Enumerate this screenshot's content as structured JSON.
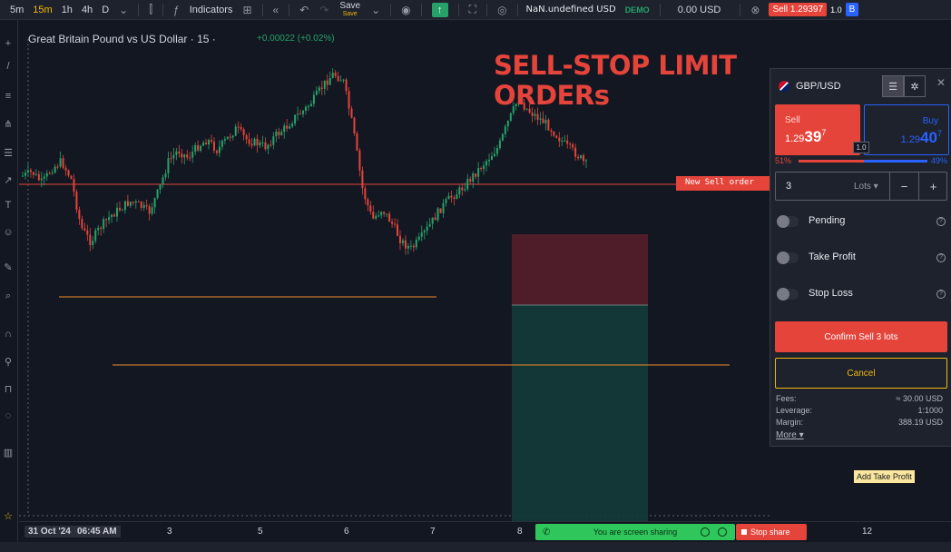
{
  "toolbar": {
    "timeframes": [
      "5m",
      "15m",
      "1h",
      "4h",
      "D"
    ],
    "active_timeframe": "15m",
    "indicators_label": "Indicators",
    "save_label": "Save",
    "save_sub_label": "Save",
    "account_label": "NaN.undefined USD",
    "account_mode": "DEMO",
    "balance": "0.00 USD",
    "sell_label": "Sell 1.29397",
    "lot": "1.0",
    "buy_label": "B"
  },
  "chart": {
    "title": "Great Britain Pound vs US Dollar · 15 ·",
    "change": "+0.00022 (+0.02%)",
    "overlay_title_1": "SELL-STOP LIMIT",
    "overlay_title_2": "ORDERs",
    "new_sell_label": "New Sell order",
    "add_tp_label": "Add Take Profit",
    "colors": {
      "up": "#26a269",
      "down": "#e5443b",
      "sell_line": "#e5443b",
      "level_line": "#f28c28"
    }
  },
  "chart_data": {
    "type": "candlestick",
    "x_labels": [
      "31 Oct '24  06:45 AM",
      "3",
      "5",
      "6",
      "7",
      "8",
      "12"
    ],
    "trend": [
      0.42,
      0.43,
      0.4,
      0.44,
      0.46,
      0.41,
      0.28,
      0.24,
      0.28,
      0.31,
      0.33,
      0.35,
      0.34,
      0.32,
      0.38,
      0.46,
      0.49,
      0.47,
      0.5,
      0.52,
      0.49,
      0.52,
      0.55,
      0.52,
      0.51,
      0.5,
      0.53,
      0.55,
      0.58,
      0.6,
      0.63,
      0.67,
      0.7,
      0.68,
      0.55,
      0.38,
      0.3,
      0.33,
      0.29,
      0.24,
      0.22,
      0.25,
      0.29,
      0.33,
      0.36,
      0.38,
      0.41,
      0.44,
      0.47,
      0.5,
      0.57,
      0.63,
      0.6,
      0.58,
      0.56,
      0.53,
      0.5,
      0.48,
      0.45
    ]
  },
  "price_line_label": "New Sell order",
  "timeaxis": {
    "dates": [
      {
        "label": "31 Oct '24",
        "bold": true
      },
      {
        "label": "06:45 AM",
        "bold": true
      },
      {
        "label": "3",
        "bold": false
      },
      {
        "label": "5",
        "bold": false
      },
      {
        "label": "6",
        "bold": false
      },
      {
        "label": "7",
        "bold": false
      },
      {
        "label": "8",
        "bold": false
      },
      {
        "label": "12",
        "bold": false
      }
    ],
    "share_text": "You are screen sharing",
    "stop_share_label": "Stop share"
  },
  "panel": {
    "symbol": "GBP/USD",
    "sell_label": "Sell",
    "sell_price_small": "1.29",
    "sell_price_big": "39",
    "sell_price_sup": "7",
    "buy_label": "Buy",
    "buy_price_small": "1.29",
    "buy_price_big": "40",
    "buy_price_sup": "7",
    "spread": "1.0",
    "sell_pct": "51%",
    "buy_pct": "49%",
    "sell_share": 0.51,
    "quantity": "3",
    "quantity_unit": "Lots",
    "options": [
      "Pending",
      "Take Profit",
      "Stop Loss"
    ],
    "confirm_label": "Confirm Sell 3 lots",
    "cancel_label": "Cancel",
    "fees_label": "Fees:",
    "fees_value": "≈ 30.00 USD",
    "leverage_label": "Leverage:",
    "leverage_value": "1:1000",
    "margin_label": "Margin:",
    "margin_value": "388.19 USD",
    "more_label": "More"
  }
}
